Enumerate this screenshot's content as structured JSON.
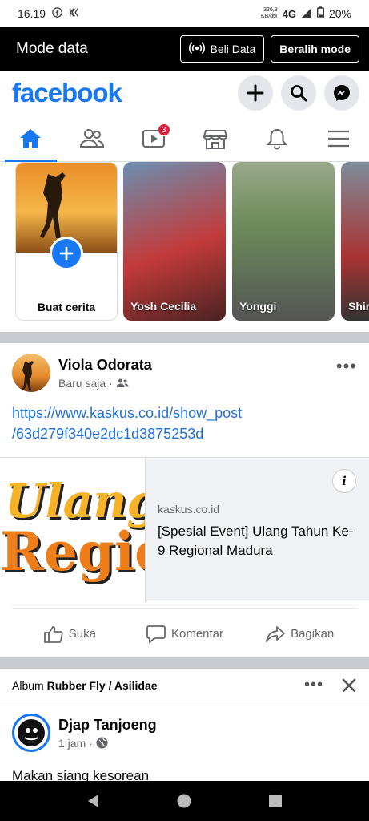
{
  "status_bar": {
    "time": "16.19",
    "speed": "336,9",
    "speed_unit": "KB/dtk",
    "network": "4G",
    "battery": "20%"
  },
  "mode_bar": {
    "title": "Mode data",
    "buy_label": "Beli Data",
    "switch_label": "Beralih mode"
  },
  "header": {
    "logo": "facebook"
  },
  "tabs": {
    "video_badge": "3"
  },
  "stories": {
    "create_label": "Buat cerita",
    "items": [
      {
        "name": "Yosh Cecilia"
      },
      {
        "name": "Yonggi"
      },
      {
        "name": "Shir"
      }
    ]
  },
  "post1": {
    "author": "Viola Odorata",
    "time": "Baru saja",
    "link": "https://www.kaskus.co.id/show_post/63d279f340e2dc1d3875253d",
    "link_line1": "https://www.kaskus.co.id/show_post",
    "link_line2": "/63d279f340e2dc1d3875253d",
    "preview": {
      "image_text1": "Ulang",
      "image_text2": "Regio",
      "domain": "kaskus.co.id",
      "title": "[Spesial Event] Ulang Tahun Ke-9 Regional Madura"
    },
    "actions": {
      "like": "Suka",
      "comment": "Komentar",
      "share": "Bagikan"
    }
  },
  "album": {
    "prefix": "Album",
    "name": "Rubber Fly / Asilidae"
  },
  "post2": {
    "author": "Djap Tanjoeng",
    "time": "1 jam",
    "caption": "Makan siang kesorean"
  }
}
